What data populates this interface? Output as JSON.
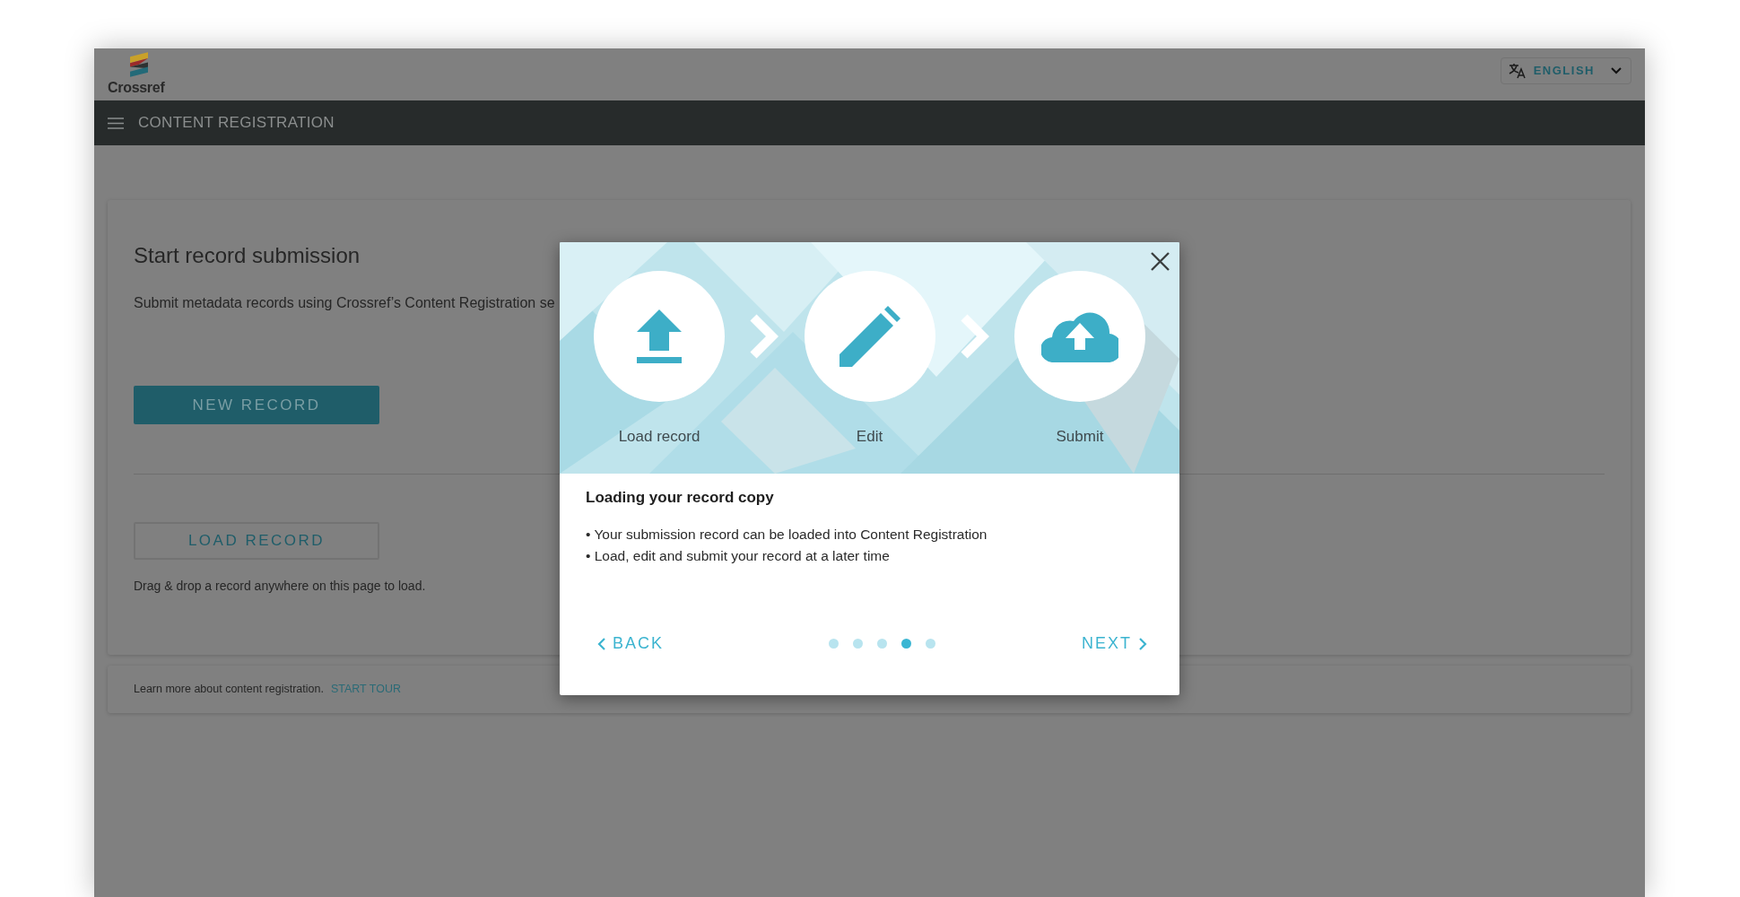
{
  "header": {
    "logo_text": "Crossref",
    "language": "ENGLISH"
  },
  "navbar": {
    "title": "CONTENT REGISTRATION"
  },
  "card": {
    "title": "Start record submission",
    "description": "Submit metadata records using Crossref’s Content Registration se",
    "new_button": "NEW RECORD",
    "load_button": "LOAD RECORD",
    "hint": "Drag & drop a record anywhere on this page to load."
  },
  "footer": {
    "text": "Learn more about content registration.",
    "link": "START TOUR"
  },
  "modal": {
    "steps": [
      {
        "kind": "load",
        "label": "Load record"
      },
      {
        "kind": "edit",
        "label": "Edit"
      },
      {
        "kind": "submit",
        "label": "Submit"
      }
    ],
    "title": "Loading your record copy",
    "bullets": [
      "• Your submission record can be loaded into Content Registration",
      "• Load, edit and submit your record at a later time"
    ],
    "back": "BACK",
    "next": "NEXT",
    "dots": [
      {
        "selected": false
      },
      {
        "selected": false
      },
      {
        "selected": false
      },
      {
        "selected": true
      },
      {
        "selected": false
      }
    ]
  }
}
